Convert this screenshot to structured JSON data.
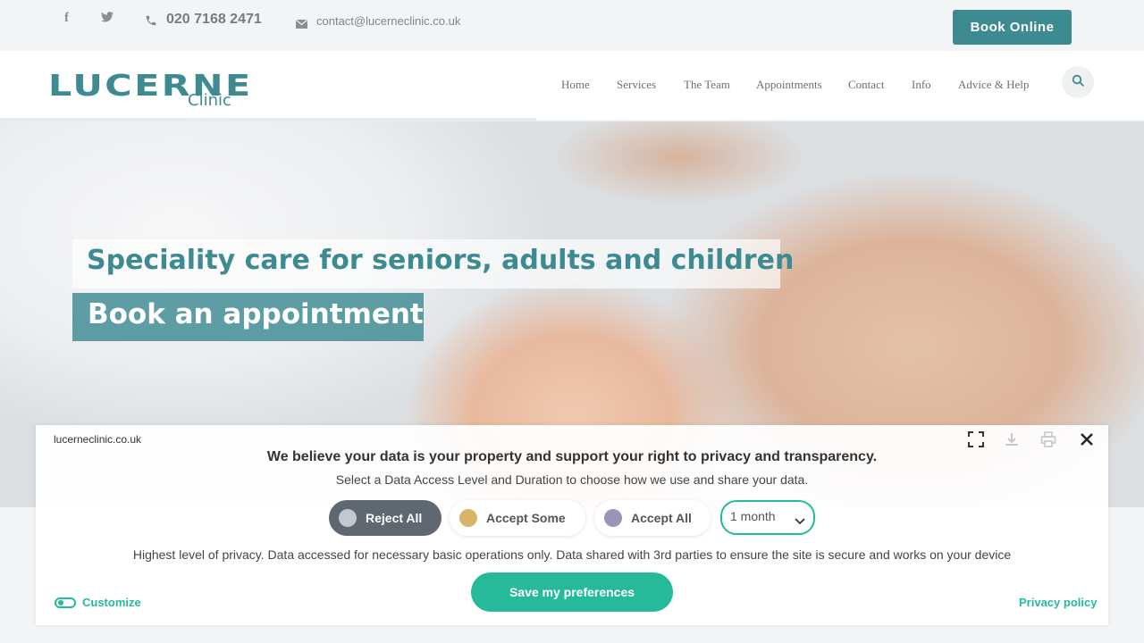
{
  "topbar": {
    "facebook_icon": "facebook-icon",
    "twitter_icon": "twitter-icon",
    "phone": "020 7168 2471",
    "email": "contact@lucerneclinic.co.uk",
    "book_online": "Book Online"
  },
  "header": {
    "logo_main": "LUCERNE",
    "logo_sub": "Clinic",
    "nav": [
      "Home",
      "Services",
      "The Team",
      "Appointments",
      "Contact",
      "Info",
      "Advice & Help"
    ],
    "search_icon": "search-icon"
  },
  "hero": {
    "title": "Speciality care for seniors, adults and children",
    "cta": "Book an appointment"
  },
  "cookie": {
    "site": "lucerneclinic.co.uk",
    "heading": "We believe your data is your property and support your right to privacy and transparency.",
    "subheading": "Select a Data Access Level and Duration to choose how we use and share your data.",
    "options": [
      {
        "label": "Reject All",
        "dot_color": "#c4c8cc"
      },
      {
        "label": "Accept Some",
        "dot_color": "#d9b56a"
      },
      {
        "label": "Accept All",
        "dot_color": "#9b94b8"
      }
    ],
    "duration": "1 month",
    "description": "Highest level of privacy. Data accessed for necessary basic operations only. Data shared with 3rd parties to ensure the site is secure and works on your device",
    "save": "Save my preferences",
    "customize": "Customize",
    "privacy_policy": "Privacy policy",
    "colors": {
      "accent": "#26b99a",
      "brand": "#3d8a91"
    }
  }
}
